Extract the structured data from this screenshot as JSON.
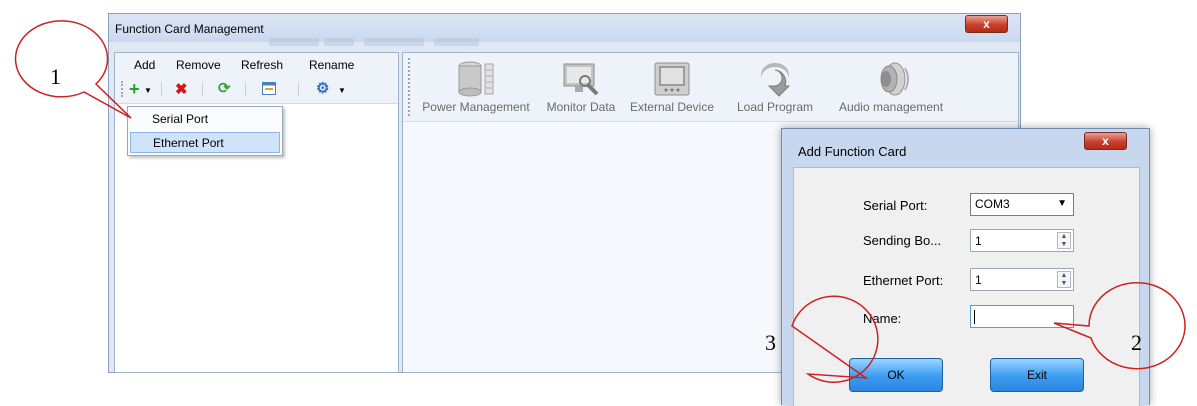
{
  "main_window": {
    "title": "Function Card Management",
    "close_glyph": "x",
    "left_menu": [
      "Add",
      "Remove",
      "Refresh",
      "Rename"
    ],
    "add_dropdown": [
      "Serial Port",
      "Ethernet Port"
    ],
    "tools": [
      {
        "label": "Power Management",
        "icon": "power-icon"
      },
      {
        "label": "Monitor Data",
        "icon": "monitor-icon"
      },
      {
        "label": "External Device",
        "icon": "device-icon"
      },
      {
        "label": "Load Program",
        "icon": "download-icon"
      },
      {
        "label": "Audio management",
        "icon": "speaker-icon"
      }
    ]
  },
  "dialog": {
    "title": "Add Function Card",
    "close_glyph": "x",
    "serial_port_label": "Serial Port:",
    "serial_port_value": "COM3",
    "sending_board_label": "Sending Bo...",
    "sending_board_value": "1",
    "ethernet_port_label": "Ethernet Port:",
    "ethernet_port_value": "1",
    "name_label": "Name:",
    "name_value": "",
    "ok_label": "OK",
    "exit_label": "Exit"
  },
  "annotations": [
    "1",
    "2",
    "3"
  ],
  "colors": {
    "accent": "#3b9bf2",
    "highlight": "#cfe3fb",
    "annotation": "#cc2222"
  }
}
